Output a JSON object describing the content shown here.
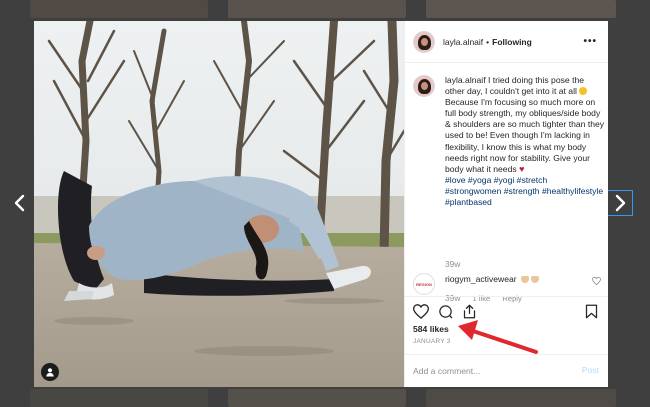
{
  "post": {
    "username": "layla.alnaif",
    "following_label": "Following",
    "more_icon": "more-horizontal-icon",
    "caption_text": "I tried doing this pose the other day, I couldn't get into it at all",
    "caption_body": "Because I'm focusing so much more on full body strength, my obliques/side body & shoulders are so much tighter than they used to be! Even though I'm lacking in flexibility, I know this is what my body needs right now for stability. Give your body what it needs",
    "hashtags": "#love #yoga #yogi #stretch #strongwomen #strength #healthylifestyle #plantbased",
    "caption_time": "39w"
  },
  "reply": {
    "username": "riogym_activewear",
    "avatar_text": "REGION",
    "time": "39w",
    "likes": "1 like",
    "reply_label": "Reply"
  },
  "engagement": {
    "likes": "584 likes",
    "date": "JANUARY 3"
  },
  "comment_box": {
    "placeholder": "Add a comment...",
    "post_label": "Post"
  },
  "icons": {
    "prev": "chevron-left-icon",
    "next": "chevron-right-icon",
    "like": "heart-icon",
    "comment": "comment-bubble-icon",
    "share": "share-icon",
    "save": "bookmark-icon",
    "tag": "user-tag-icon"
  },
  "colors": {
    "annotation_arrow": "#e0282e",
    "hashtag": "#00376b",
    "post_button": "#b3dbff"
  }
}
